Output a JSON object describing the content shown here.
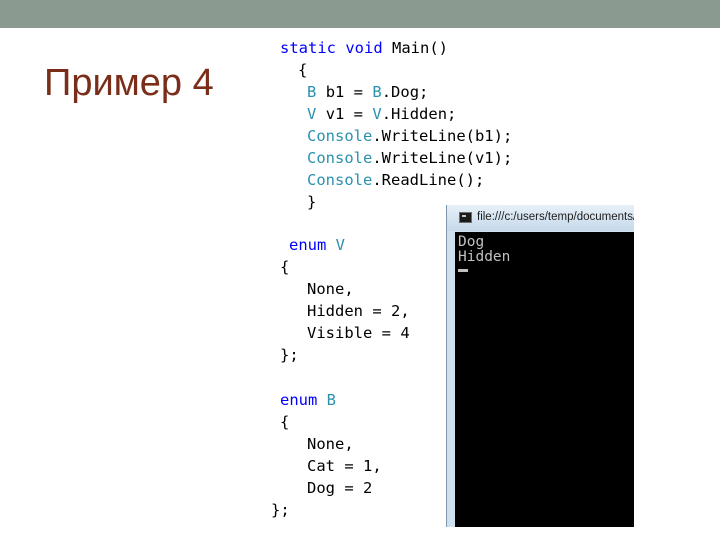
{
  "slide": {
    "title": "Пример 4"
  },
  "code": {
    "main": {
      "l1": [
        "static",
        "void",
        "Main()"
      ],
      "l2": "{",
      "l3": [
        "B",
        "b1 =",
        "B",
        ".Dog;"
      ],
      "l4": [
        "V",
        "v1 =",
        "V",
        ".Hidden;"
      ],
      "l5": [
        "Console",
        ".WriteLine(b1);"
      ],
      "l6": [
        "Console",
        ".WriteLine(v1);"
      ],
      "l7": [
        "Console",
        ".ReadLine();"
      ],
      "l8": "}"
    },
    "enum_v": {
      "l1": [
        "enum",
        "V"
      ],
      "l2": "{",
      "l3": "None,",
      "l4": "Hidden = 2,",
      "l5": "Visible = 4",
      "l6": "};"
    },
    "enum_b": {
      "l1": [
        "enum",
        "B"
      ],
      "l2": "{",
      "l3": "None,",
      "l4": "Cat = 1,",
      "l5": "Dog = 2",
      "l6": "};"
    }
  },
  "console": {
    "title": "file:///c:/users/temp/documents/vi",
    "output": [
      "Dog",
      "Hidden"
    ]
  },
  "colors": {
    "keyword": "#0000ff",
    "type": "#2b91af",
    "title": "#7a2e1a",
    "top_bar": "#8a9a90"
  }
}
